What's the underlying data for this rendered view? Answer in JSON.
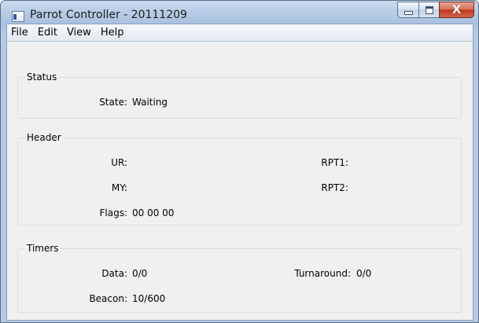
{
  "window": {
    "title": "Parrot Controller - 20111209",
    "caption_buttons": {
      "minimize_icon": "minimize-icon",
      "maximize_icon": "maximize-icon",
      "close_glyph": "X"
    }
  },
  "menu": [
    "File",
    "Edit",
    "View",
    "Help"
  ],
  "status": {
    "title": "Status",
    "state_label": "State:",
    "state_value": "Waiting"
  },
  "header": {
    "title": "Header",
    "ur_label": "UR:",
    "ur_value": "",
    "my_label": "MY:",
    "my_value": "",
    "flags_label": "Flags:",
    "flags_value": "00 00 00",
    "rpt1_label": "RPT1:",
    "rpt1_value": "",
    "rpt2_label": "RPT2:",
    "rpt2_value": ""
  },
  "timers": {
    "title": "Timers",
    "data_label": "Data:",
    "data_value": "0/0",
    "beacon_label": "Beacon:",
    "beacon_value": "10/600",
    "turnaround_label": "Turnaround:",
    "turnaround_value": "0/0"
  },
  "colors": {
    "title_bar": "#b9cde6",
    "client_background": "#f0f0f0",
    "close_button": "#c0391f"
  }
}
